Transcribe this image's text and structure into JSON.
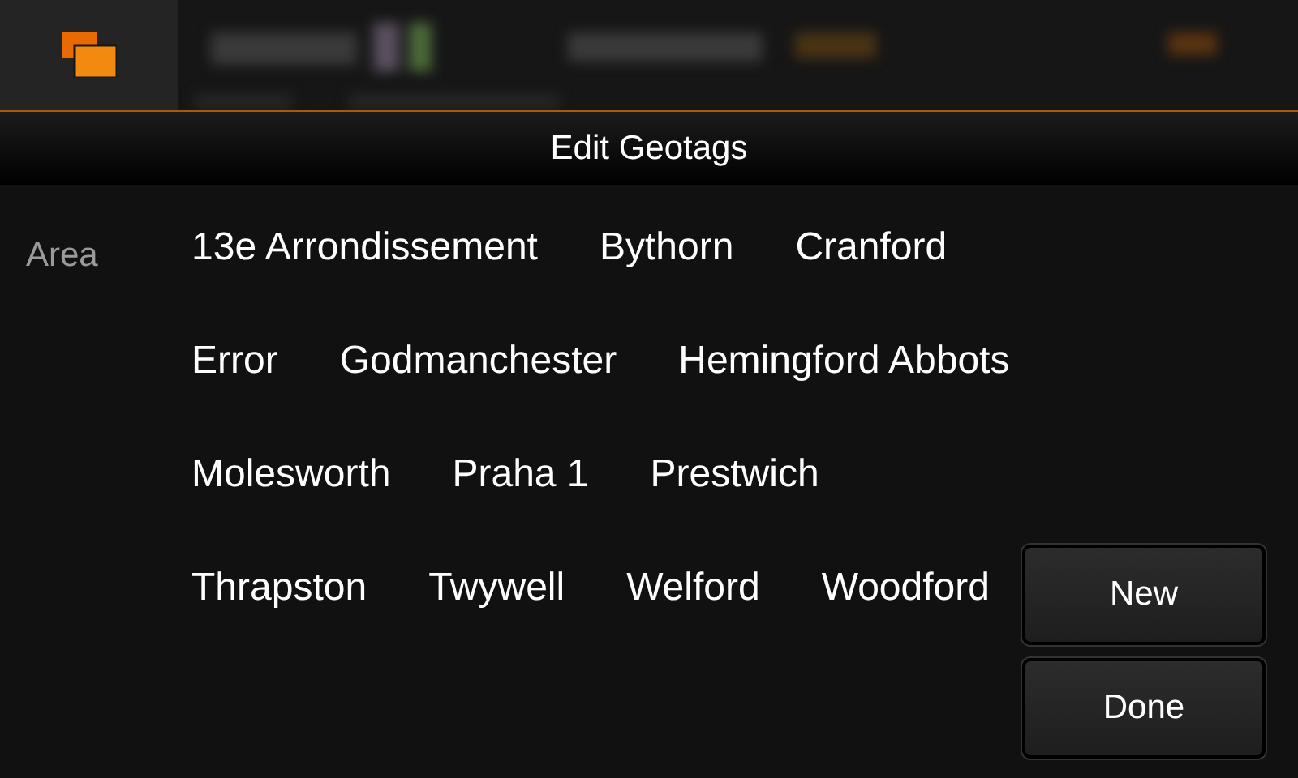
{
  "dialog": {
    "title": "Edit Geotags"
  },
  "area_label": "Area",
  "tags": [
    "13e Arrondissement",
    "Bythorn",
    "Cranford",
    "Error",
    "Godmanchester",
    "Hemingford Abbots",
    "Molesworth",
    "Praha 1",
    "Prestwich",
    "Thrapston",
    "Twywell",
    "Welford",
    "Woodford"
  ],
  "buttons": [
    "New",
    "Done"
  ]
}
